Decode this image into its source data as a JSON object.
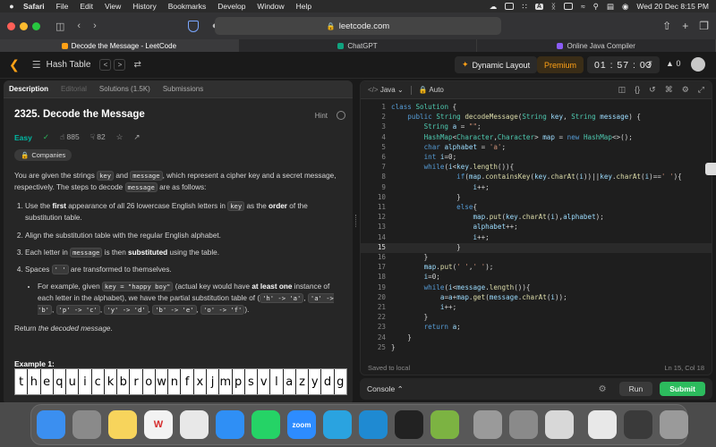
{
  "menubar": {
    "app": "Safari",
    "items": [
      "File",
      "Edit",
      "View",
      "History",
      "Bookmarks",
      "Develop",
      "Window",
      "Help"
    ],
    "ai_badge": "A",
    "datetime": "Wed 20 Dec  8:15 PM"
  },
  "browser": {
    "url": "leetcode.com",
    "tabs": [
      {
        "title": "Decode the Message - LeetCode",
        "color": "#ffa116"
      },
      {
        "title": "ChatGPT",
        "color": "#10a37f"
      },
      {
        "title": "Online Java Compiler",
        "color": "#8b5cf6"
      }
    ]
  },
  "lc": {
    "problem_list": "Hash Table",
    "prev_icon": "<",
    "next_icon": ">",
    "dynamic_layout": "Dynamic Layout",
    "premium": "Premium",
    "timer": "01 : 57 : 03",
    "streak": "0"
  },
  "description": {
    "tabs": [
      "Description",
      "Editorial",
      "Solutions (1.5K)",
      "Submissions"
    ],
    "title": "2325. Decode the Message",
    "hint": "Hint",
    "difficulty": "Easy",
    "likes": "885",
    "dislikes": "82",
    "companies": "Companies",
    "intro_a": "You are given the strings ",
    "intro_key": "key",
    "intro_b": " and ",
    "intro_message": "message",
    "intro_c": ", which represent a cipher key and a secret message, respectively. The steps to decode ",
    "intro_d": " are as follows:",
    "step1_a": "Use the ",
    "step1_b": "first",
    "step1_c": " appearance of all 26 lowercase English letters in ",
    "step1_d": " as the ",
    "step1_e": "order",
    "step1_f": " of the substitution table.",
    "step2": "Align the substitution table with the regular English alphabet.",
    "step3_a": "Each letter in ",
    "step3_b": " is then ",
    "step3_c": "substituted",
    "step3_d": " using the table.",
    "step4_a": "Spaces ",
    "step4_code": "' '",
    "step4_b": " are transformed to themselves.",
    "bullet_a": "For example, given ",
    "bullet_code1": "key = \"happy boy\"",
    "bullet_b": " (actual key would have ",
    "bullet_bold": "at least one",
    "bullet_c": " instance of each letter in the alphabet), we have the partial substitution table of (",
    "bullet_m1": "'h' -> 'a'",
    "bullet_m2": "'a' -> 'b'",
    "bullet_m3": "'p' -> 'c'",
    "bullet_m4": "'y' -> 'd'",
    "bullet_m5": "'b' -> 'e'",
    "bullet_m6": "'o' -> 'f'",
    "bullet_sep": ", ",
    "bullet_end": ").",
    "return_a": "Return ",
    "return_b": "the decoded message",
    "return_c": ".",
    "example_title": "Example 1:",
    "cipher_letters": [
      "t",
      "h",
      "e",
      "q",
      "u",
      "i",
      "c",
      "k",
      "b",
      "r",
      "o",
      "w",
      "n",
      "f",
      "x",
      "j",
      "m",
      "p",
      "s",
      "v",
      "l",
      "a",
      "z",
      "y",
      "d",
      "g"
    ]
  },
  "editor": {
    "language": "Java",
    "mode": "Auto",
    "status": "Saved to local",
    "cursor": "Ln 15, Col 18",
    "current_line": 15,
    "lines": [
      "class Solution {",
      "    public String decodeMessage(String key, String message) {",
      "        String a = \"\";",
      "        HashMap<Character,Character> map = new HashMap<>();",
      "        char alphabet = 'a';",
      "        int i=0;",
      "        while(i<key.length()){",
      "                if(map.containsKey(key.charAt(i))||key.charAt(i)==' '){",
      "                    i++;",
      "                }",
      "                else{",
      "                    map.put(key.charAt(i),alphabet);",
      "                    alphabet++;",
      "                    i++;",
      "                }",
      "        }",
      "        map.put(' ',' ');",
      "        i=0;",
      "        while(i<message.length()){",
      "            a=a+map.get(message.charAt(i));",
      "            i++;",
      "        }",
      "        return a;",
      "    }",
      "}"
    ]
  },
  "console": {
    "label": "Console",
    "run": "Run",
    "submit": "Submit"
  },
  "dock": {
    "apps": [
      {
        "name": "finder",
        "color": "#3b8ff0",
        "glyph": ""
      },
      {
        "name": "launchpad",
        "color": "#8a8a8a",
        "glyph": ""
      },
      {
        "name": "notes",
        "color": "#f7d45c",
        "glyph": ""
      },
      {
        "name": "wps",
        "color": "#f2f2f2",
        "glyph": "W"
      },
      {
        "name": "chrome",
        "color": "#e8e8e8",
        "glyph": ""
      },
      {
        "name": "safari",
        "color": "#2f8ff5",
        "glyph": ""
      },
      {
        "name": "whatsapp",
        "color": "#25d366",
        "glyph": ""
      },
      {
        "name": "zoom",
        "color": "#2d8cff",
        "glyph": "zoom"
      },
      {
        "name": "telegram",
        "color": "#2aa3e0",
        "glyph": ""
      },
      {
        "name": "vscode",
        "color": "#1f8ad2",
        "glyph": ""
      },
      {
        "name": "activity-monitor",
        "color": "#222",
        "glyph": ""
      },
      {
        "name": "android-studio",
        "color": "#7cb342",
        "glyph": ""
      },
      {
        "name": "quicktime",
        "color": "#9a9a9a",
        "glyph": ""
      },
      {
        "name": "system-settings",
        "color": "#8a8a8a",
        "glyph": ""
      },
      {
        "name": "preview",
        "color": "#d8d8d8",
        "glyph": ""
      },
      {
        "name": "window-1",
        "color": "#e8e8e8",
        "glyph": ""
      },
      {
        "name": "window-2",
        "color": "#3a3a3a",
        "glyph": ""
      },
      {
        "name": "trash",
        "color": "#9a9a9a",
        "glyph": ""
      }
    ]
  }
}
